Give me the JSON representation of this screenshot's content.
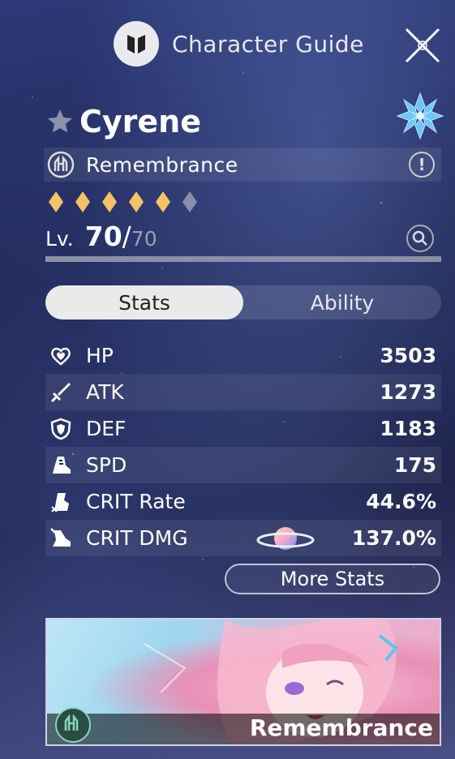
{
  "header": {
    "title": "Character Guide",
    "logo_icon": "path-emblem-icon",
    "close_icon": "close-icon"
  },
  "character": {
    "name": "Cyrene",
    "favorite_icon": "star-icon",
    "element_icon": "ice-element-icon",
    "path": "Remembrance",
    "rarity": {
      "filled": 5,
      "total": 6
    },
    "level": {
      "label": "Lv.",
      "current": "70",
      "separator": "/",
      "max": "70"
    }
  },
  "tabs": [
    {
      "label": "Stats",
      "active": true
    },
    {
      "label": "Ability",
      "active": false
    }
  ],
  "stats": [
    {
      "name": "HP",
      "value": "3503",
      "icon": "heart-icon"
    },
    {
      "name": "ATK",
      "value": "1273",
      "icon": "sword-icon"
    },
    {
      "name": "DEF",
      "value": "1183",
      "icon": "shield-icon"
    },
    {
      "name": "SPD",
      "value": "175",
      "icon": "boot-icon"
    },
    {
      "name": "CRIT Rate",
      "value": "44.6%",
      "icon": "crit-rate-icon"
    },
    {
      "name": "CRIT DMG",
      "value": "137.0%",
      "icon": "crit-dmg-icon"
    }
  ],
  "more_stats_label": "More Stats",
  "banner": {
    "label": "Remembrance",
    "icon": "remembrance-path-icon"
  },
  "colors": {
    "rarity_gold": "#f5c266",
    "rarity_dim": "#8a8fa8",
    "ice": "#6ec6ff"
  }
}
